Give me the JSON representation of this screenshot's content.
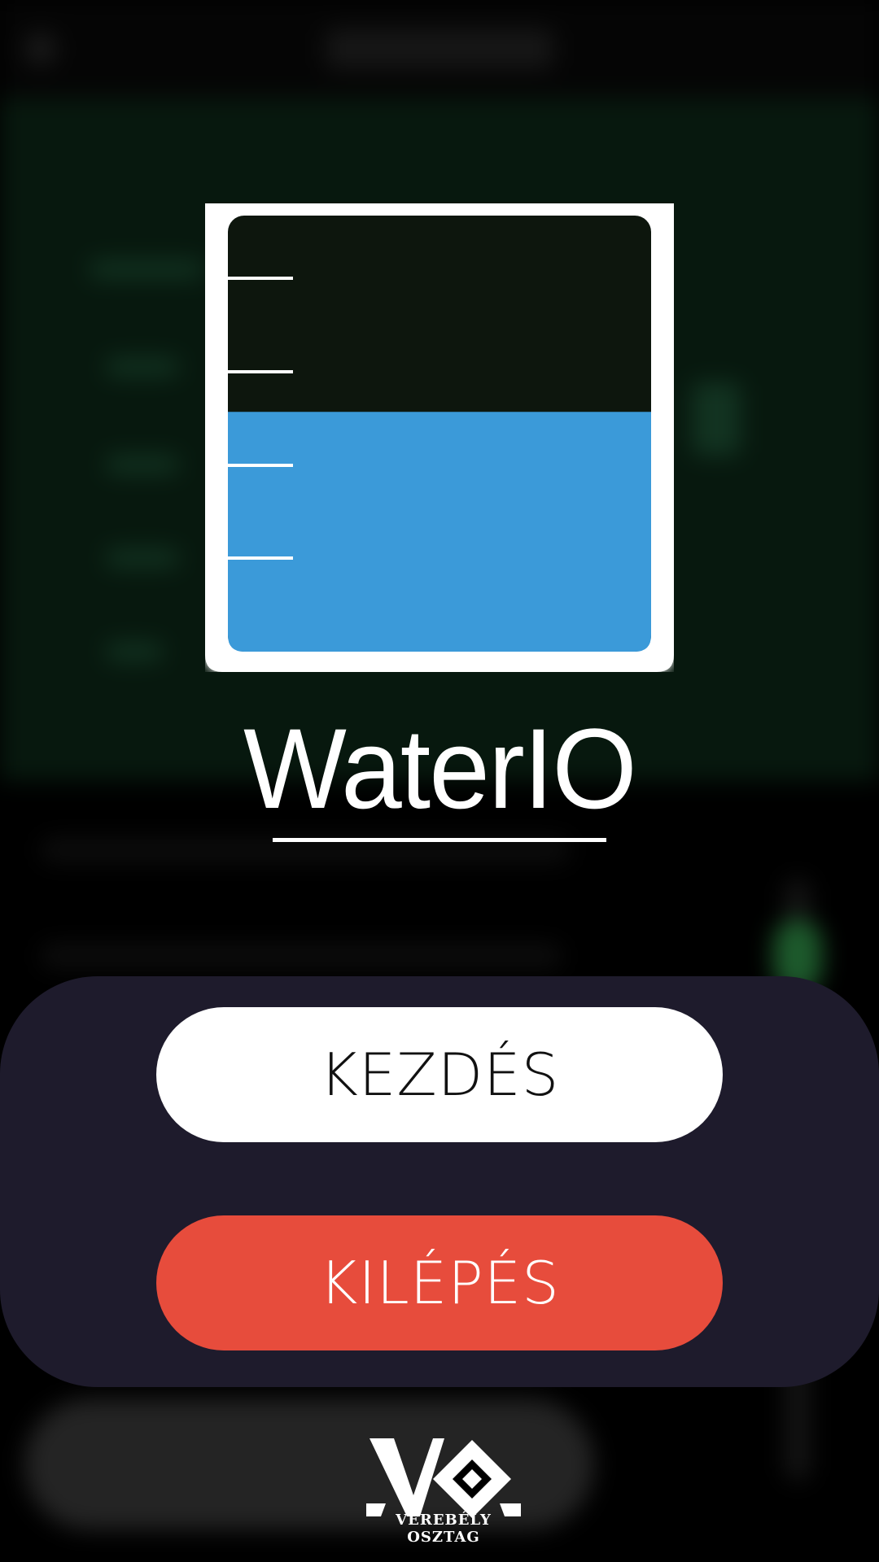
{
  "app": {
    "title": "WaterIO"
  },
  "menu": {
    "start_label": "KEZDÉS",
    "exit_label": "KILÉPÉS"
  },
  "beaker": {
    "icon": "beaker-icon",
    "fill_level": 0.55,
    "water_color": "#3a9ad9",
    "tick_count": 4
  },
  "credit": {
    "text": "VEREBÉLY OSZTAG",
    "logo_letters": "VO"
  },
  "colors": {
    "start_button": "#ffffff",
    "exit_button": "#e74c3c",
    "menu_panel": "#1e1b2c",
    "background_panel": "#07180e"
  }
}
